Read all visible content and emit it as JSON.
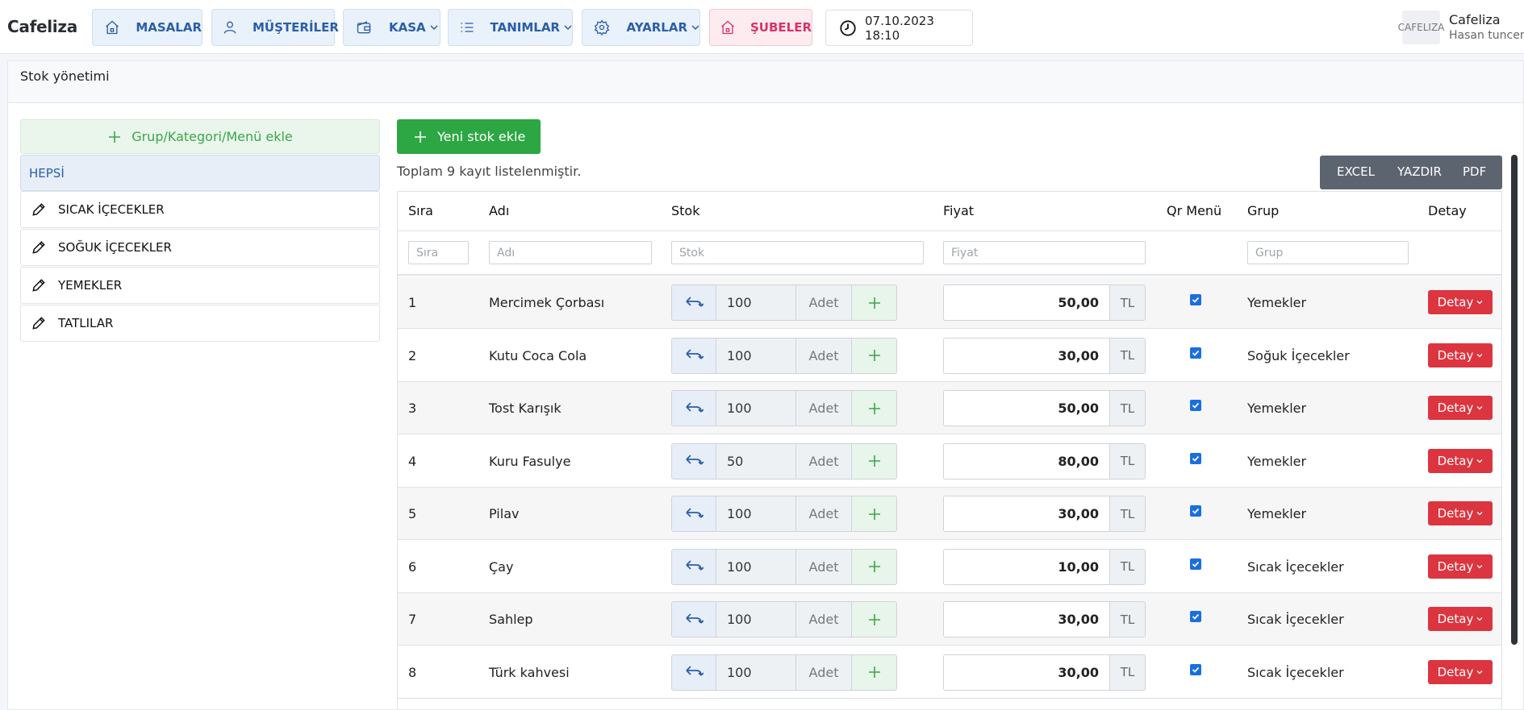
{
  "app": {
    "brand": "Cafeliza"
  },
  "nav": {
    "items": [
      {
        "label": "MASALAR",
        "icon": "home-icon",
        "dropdown": false
      },
      {
        "label": "MÜŞTERİLER",
        "icon": "user-icon",
        "dropdown": false
      },
      {
        "label": "KASA",
        "icon": "wallet-icon",
        "dropdown": true
      },
      {
        "label": "TANIMLAR",
        "icon": "list-icon",
        "dropdown": true
      },
      {
        "label": "AYARLAR",
        "icon": "gear-icon",
        "dropdown": true
      },
      {
        "label": "ŞUBELER",
        "icon": "home-icon",
        "dropdown": false
      }
    ],
    "datetime": "07.10.2023 18:10"
  },
  "user": {
    "avatar_text": "CAFELIZA",
    "name": "Cafeliza",
    "role": "Hasan tuncer"
  },
  "page": {
    "title": "Stok yönetimi"
  },
  "categories": {
    "add_label": "Grup/Kategori/Menü ekle",
    "all_label": "HEPSİ",
    "items": [
      "SICAK İÇECEKLER",
      "SOĞUK İÇECEKLER",
      "YEMEKLER",
      "TATLILAR"
    ]
  },
  "toolbar": {
    "new_stock_label": "Yeni stok ekle",
    "record_count_text": "Toplam 9 kayıt listelenmiştir.",
    "export": [
      "EXCEL",
      "YAZDIR",
      "PDF"
    ]
  },
  "table": {
    "headers": {
      "sira": "Sıra",
      "adi": "Adı",
      "stok": "Stok",
      "fiyat": "Fiyat",
      "qr": "Qr Menü",
      "grup": "Grup",
      "detay": "Detay"
    },
    "filters": {
      "sira": "Sıra",
      "adi": "Adı",
      "stok": "Stok",
      "fiyat": "Fiyat",
      "grup": "Grup"
    },
    "unit_label": "Adet",
    "currency_label": "TL",
    "detail_label": "Detay",
    "rows": [
      {
        "sira": "1",
        "adi": "Mercimek Çorbası",
        "stok": "100",
        "fiyat": "50,00",
        "qr": true,
        "grup": "Yemekler"
      },
      {
        "sira": "2",
        "adi": "Kutu Coca Cola",
        "stok": "100",
        "fiyat": "30,00",
        "qr": true,
        "grup": "Soğuk İçecekler"
      },
      {
        "sira": "3",
        "adi": "Tost Karışık",
        "stok": "100",
        "fiyat": "50,00",
        "qr": true,
        "grup": "Yemekler"
      },
      {
        "sira": "4",
        "adi": "Kuru Fasulye",
        "stok": "50",
        "fiyat": "80,00",
        "qr": true,
        "grup": "Yemekler"
      },
      {
        "sira": "5",
        "adi": "Pilav",
        "stok": "100",
        "fiyat": "30,00",
        "qr": true,
        "grup": "Yemekler"
      },
      {
        "sira": "6",
        "adi": "Çay",
        "stok": "100",
        "fiyat": "10,00",
        "qr": true,
        "grup": "Sıcak İçecekler"
      },
      {
        "sira": "7",
        "adi": "Sahlep",
        "stok": "100",
        "fiyat": "30,00",
        "qr": true,
        "grup": "Sıcak İçecekler"
      },
      {
        "sira": "8",
        "adi": "Türk kahvesi",
        "stok": "100",
        "fiyat": "30,00",
        "qr": true,
        "grup": "Sıcak İçecekler"
      }
    ]
  }
}
